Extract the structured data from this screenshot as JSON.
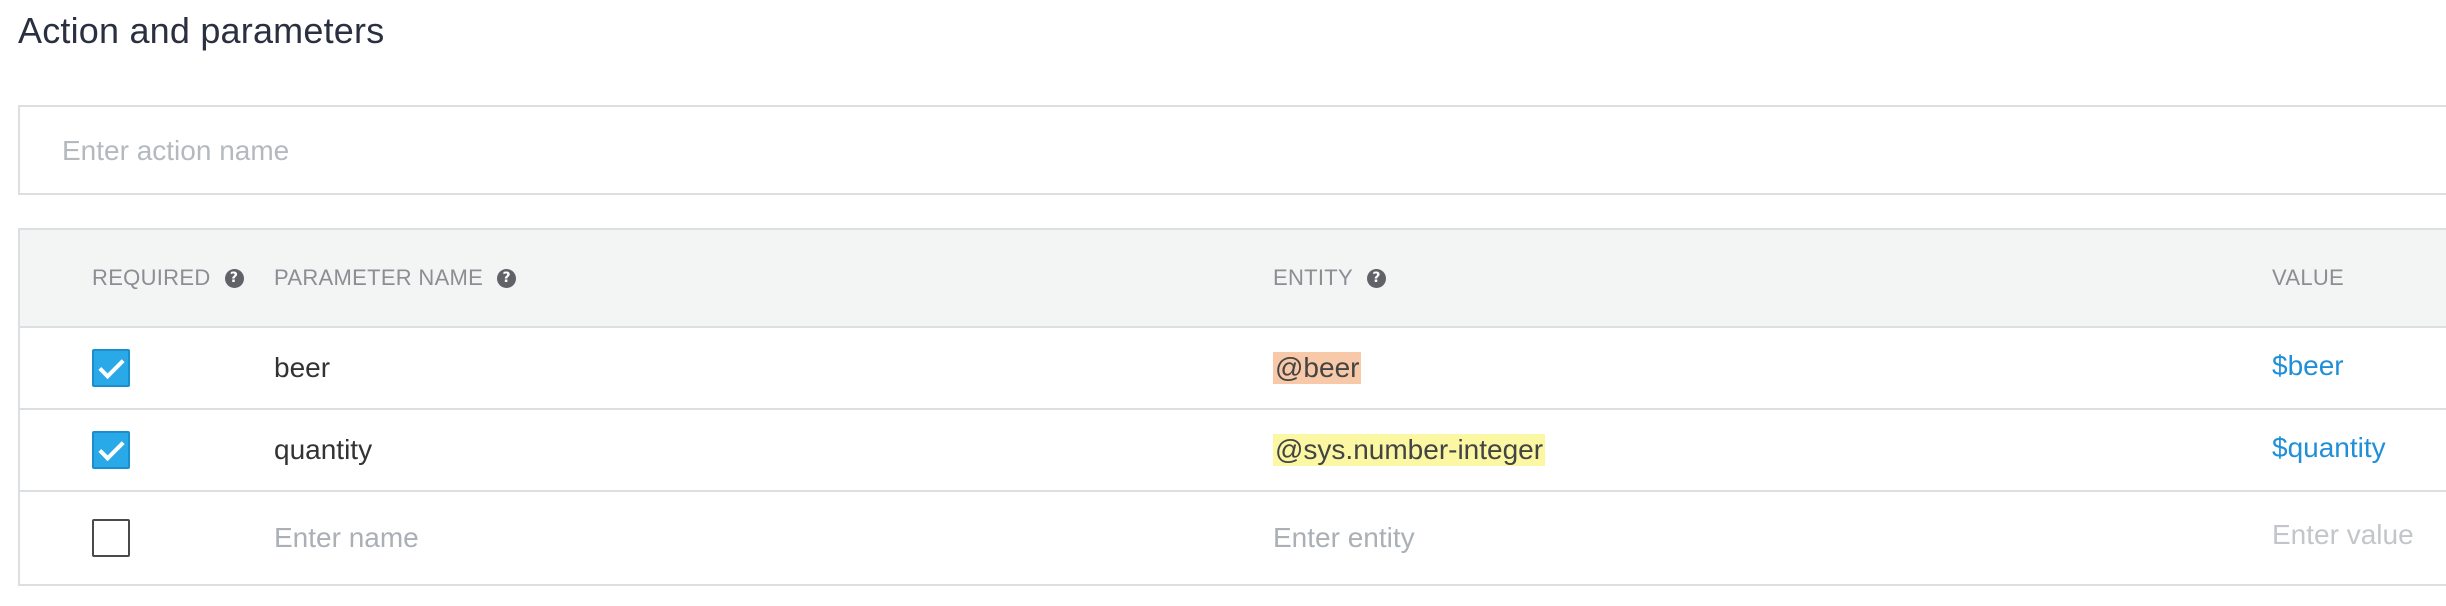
{
  "section": {
    "title": "Action and parameters"
  },
  "action": {
    "placeholder": "Enter action name",
    "value": ""
  },
  "table": {
    "headers": {
      "required": "REQUIRED",
      "parameter_name": "PARAMETER NAME",
      "entity": "ENTITY",
      "value": "VALUE"
    },
    "help_icon_glyph": "?",
    "rows": [
      {
        "required": true,
        "name": "beer",
        "entity": "@beer",
        "entity_color": "#f8c9a8",
        "value": "$beer"
      },
      {
        "required": true,
        "name": "quantity",
        "entity": "@sys.number-integer",
        "entity_color": "#fbf7a2",
        "value": "$quantity"
      }
    ],
    "new_row": {
      "required": false,
      "name_placeholder": "Enter name",
      "entity_placeholder": "Enter entity",
      "value_placeholder": "Enter value"
    }
  },
  "colors": {
    "accent": "#29a9e8",
    "value_link": "#1f8fd8",
    "header_bg": "#f3f4f4",
    "border": "#dcdfe2"
  }
}
